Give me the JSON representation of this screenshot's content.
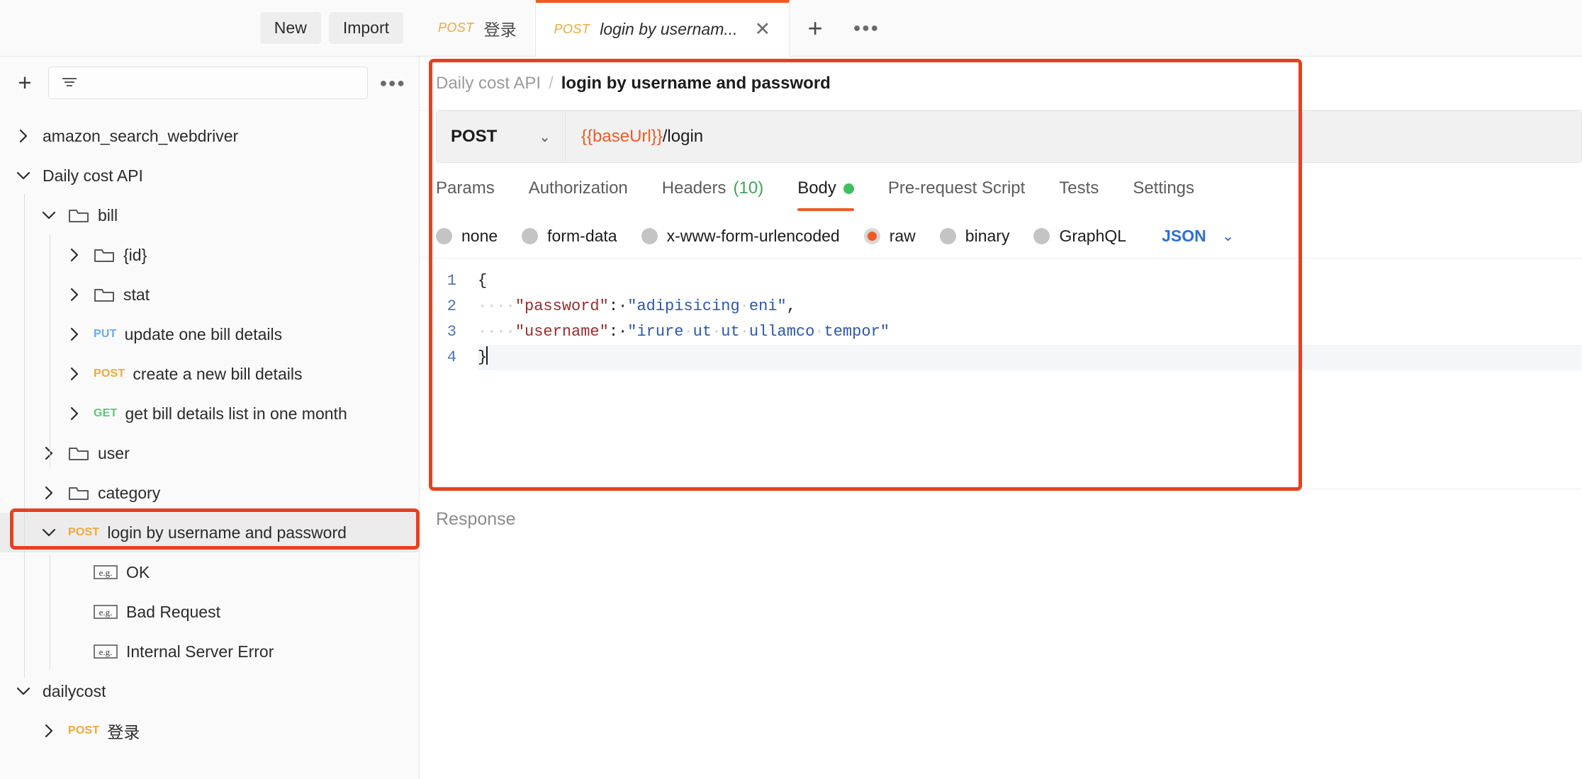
{
  "toolbar": {
    "new_label": "New",
    "import_label": "Import"
  },
  "tabs": {
    "items": [
      {
        "method": "POST",
        "label": "登录",
        "active": false
      },
      {
        "method": "POST",
        "label": "login by usernam...",
        "active": true
      }
    ],
    "new_tab_icon": "plus-icon",
    "more_icon": "ellipsis-icon",
    "close_icon": "close-icon"
  },
  "sidebar": {
    "add_icon": "plus-icon",
    "filter_icon": "filter-icon",
    "filter_placeholder": "",
    "more_icon": "ellipsis-icon",
    "tree": [
      {
        "label": "amazon_search_webdriver",
        "depth": 0,
        "expanded": false,
        "kind": "collection",
        "method": ""
      },
      {
        "label": "Daily cost API",
        "depth": 0,
        "expanded": true,
        "kind": "collection",
        "method": ""
      },
      {
        "label": "bill",
        "depth": 1,
        "expanded": true,
        "kind": "folder",
        "method": ""
      },
      {
        "label": "{id}",
        "depth": 2,
        "expanded": false,
        "kind": "folder",
        "method": ""
      },
      {
        "label": "stat",
        "depth": 2,
        "expanded": false,
        "kind": "folder",
        "method": ""
      },
      {
        "label": "update one bill details",
        "depth": 2,
        "expanded": false,
        "kind": "request",
        "method": "PUT"
      },
      {
        "label": "create a new bill details",
        "depth": 2,
        "expanded": false,
        "kind": "request",
        "method": "POST"
      },
      {
        "label": "get bill details list in one month",
        "depth": 2,
        "expanded": false,
        "kind": "request",
        "method": "GET"
      },
      {
        "label": "user",
        "depth": 1,
        "expanded": false,
        "kind": "folder",
        "method": ""
      },
      {
        "label": "category",
        "depth": 1,
        "expanded": false,
        "kind": "folder",
        "method": ""
      },
      {
        "label": "login by username and password",
        "depth": 1,
        "expanded": true,
        "kind": "request",
        "method": "POST",
        "selected": true
      },
      {
        "label": "OK",
        "depth": 2,
        "expanded": false,
        "kind": "example",
        "method": ""
      },
      {
        "label": "Bad Request",
        "depth": 2,
        "expanded": false,
        "kind": "example",
        "method": ""
      },
      {
        "label": "Internal Server Error",
        "depth": 2,
        "expanded": false,
        "kind": "example",
        "method": ""
      },
      {
        "label": "dailycost",
        "depth": 0,
        "expanded": true,
        "kind": "collection",
        "method": ""
      },
      {
        "label": "登录",
        "depth": 1,
        "expanded": false,
        "kind": "request",
        "method": "POST"
      }
    ],
    "example_icon_text": "e.g."
  },
  "request": {
    "breadcrumb_parent": "Daily cost API",
    "breadcrumb_separator": "/",
    "breadcrumb_current": "login by username and password",
    "method": "POST",
    "method_caret_icon": "chevron-down-icon",
    "url_variable": "{{baseUrl}}",
    "url_path": "/login",
    "tabs": [
      {
        "label": "Params",
        "count": "",
        "active": false,
        "dot": false
      },
      {
        "label": "Authorization",
        "count": "",
        "active": false,
        "dot": false
      },
      {
        "label": "Headers",
        "count": "(10)",
        "active": false,
        "dot": false
      },
      {
        "label": "Body",
        "count": "",
        "active": true,
        "dot": true
      },
      {
        "label": "Pre-request Script",
        "count": "",
        "active": false,
        "dot": false
      },
      {
        "label": "Tests",
        "count": "",
        "active": false,
        "dot": false
      },
      {
        "label": "Settings",
        "count": "",
        "active": false,
        "dot": false
      }
    ],
    "body_modes": [
      {
        "label": "none",
        "selected": false
      },
      {
        "label": "form-data",
        "selected": false
      },
      {
        "label": "x-www-form-urlencoded",
        "selected": false
      },
      {
        "label": "raw",
        "selected": true
      },
      {
        "label": "binary",
        "selected": false
      },
      {
        "label": "GraphQL",
        "selected": false
      }
    ],
    "raw_format": "JSON",
    "raw_format_caret_icon": "chevron-down-icon",
    "editor": {
      "line_numbers": [
        "1",
        "2",
        "3",
        "4"
      ],
      "lines": [
        {
          "n": "1",
          "text": "{"
        },
        {
          "n": "2",
          "text": "    \"password\": \"adipisicing eni\","
        },
        {
          "n": "3",
          "text": "    \"username\": \"irure ut ut ullamco tempor\""
        },
        {
          "n": "4",
          "text": "}"
        }
      ],
      "body_json": {
        "password": "adipisicing eni",
        "username": "irure ut ut ullamco tempor"
      }
    }
  },
  "response": {
    "placeholder": "Response"
  },
  "colors": {
    "accent_orange": "#ef5b25",
    "annotation_red": "#e8401f",
    "method_post": "#f0a83c",
    "method_put": "#6aa9ee",
    "method_get": "#5cc77e",
    "json_blue": "#2b6fd8",
    "green_dot": "#3fbf5f"
  }
}
